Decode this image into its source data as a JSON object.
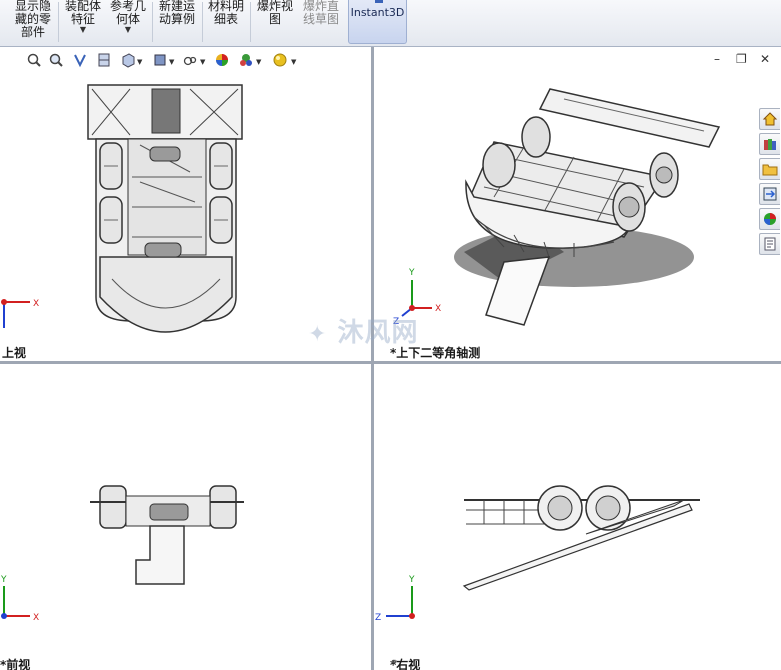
{
  "ribbon": {
    "buttons": [
      {
        "label": "显示隐\n藏的零\n部件",
        "dropdown": false,
        "dim": false
      },
      {
        "label": "装配体\n特征",
        "dropdown": true,
        "dim": false
      },
      {
        "label": "参考几\n何体",
        "dropdown": true,
        "dim": false
      },
      {
        "label": "新建运\n动算例",
        "dropdown": false,
        "dim": false
      },
      {
        "label": "材料明\n细表",
        "dropdown": false,
        "dim": false
      },
      {
        "label": "爆炸视\n图",
        "dropdown": false,
        "dim": false
      },
      {
        "label": "爆炸直\n线草图",
        "dropdown": false,
        "dim": true
      }
    ],
    "instant3d": "Instant3D"
  },
  "hud_icons": [
    "zoom-to-fit-icon",
    "zoom-area-icon",
    "previous-view-icon",
    "section-view-icon",
    "view-orientation-icon",
    "display-style-icon",
    "hide-show-items-icon",
    "edit-appearance-icon",
    "apply-scene-icon",
    "view-settings-icon"
  ],
  "viewports": {
    "top_left": {
      "title": "上视"
    },
    "top_right": {
      "title": "*上下二等角轴测"
    },
    "bottom_left": {
      "title": "*前视"
    },
    "bottom_right": {
      "title": "*右视"
    }
  },
  "triad": {
    "x": "X",
    "y": "Y",
    "z": "Z"
  },
  "watermark": "沐风网",
  "taskpane_icons": [
    "solidworks-resources-icon",
    "design-library-icon",
    "file-explorer-icon",
    "view-palette-icon",
    "appearances-icon",
    "custom-properties-icon"
  ],
  "colors": {
    "accent": "#3a63b8",
    "x_axis": "#d22020",
    "y_axis": "#1a9a1a",
    "z_axis": "#2040d0"
  }
}
